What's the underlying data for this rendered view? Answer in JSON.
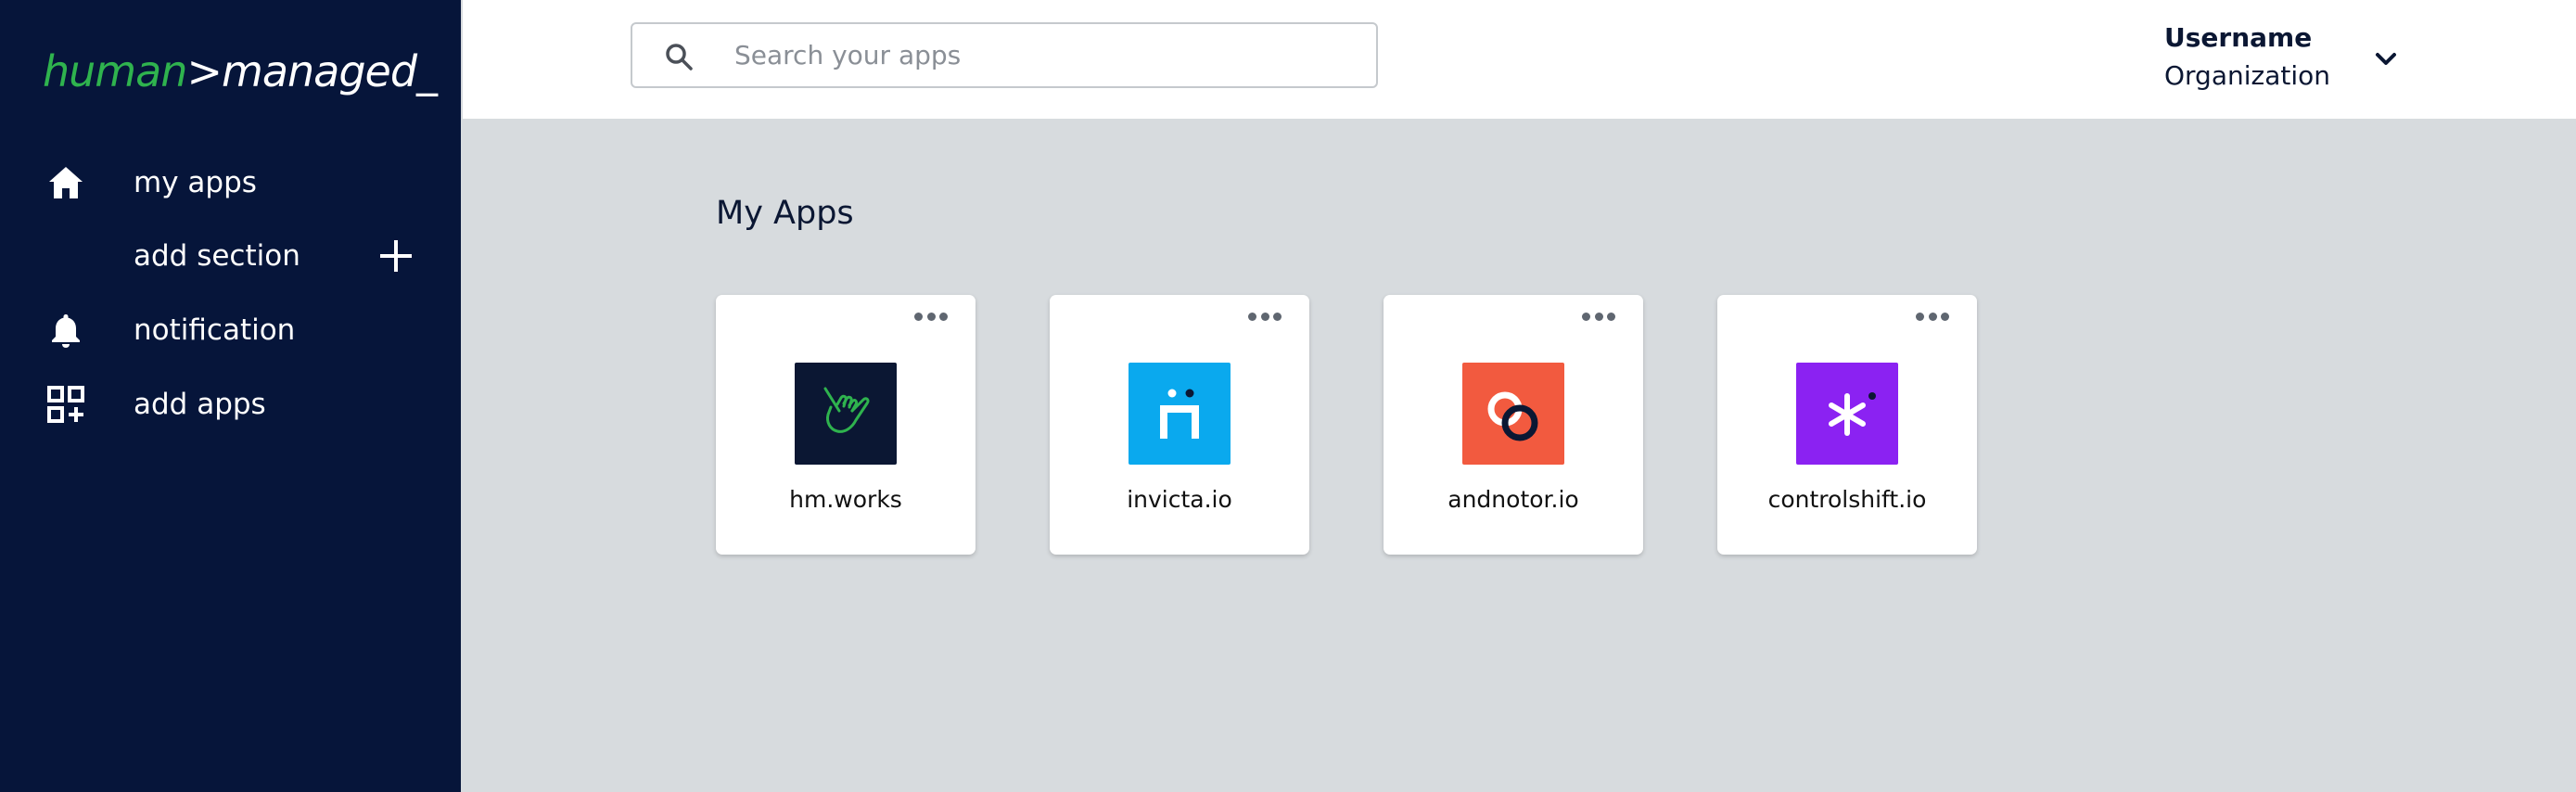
{
  "brand": {
    "part1": "human",
    "part2": ">managed_"
  },
  "sidebar": {
    "items": [
      {
        "label": "my apps",
        "icon": "home-icon"
      },
      {
        "label": "add section",
        "icon": "plus-icon"
      },
      {
        "label": "notification",
        "icon": "bell-icon"
      },
      {
        "label": "add apps",
        "icon": "add-apps-grid-icon"
      }
    ]
  },
  "search": {
    "placeholder": "Search your apps",
    "value": ""
  },
  "user": {
    "username": "Username",
    "organization": "Organization"
  },
  "main": {
    "title": "My Apps",
    "apps": [
      {
        "name": "hm.works",
        "logo_color": "#0b1733",
        "icon": "hand-icon"
      },
      {
        "name": "invicta.io",
        "logo_color": "#0aa9ee",
        "icon": "invicta-logo-icon"
      },
      {
        "name": "andnotor.io",
        "logo_color": "#f25a3f",
        "icon": "rings-icon"
      },
      {
        "name": "controlshift.io",
        "logo_color": "#8b22f2",
        "icon": "asterisk-icon"
      }
    ]
  },
  "colors": {
    "sidebar_bg": "#06153a",
    "brand_green": "#2fb34e",
    "main_bg": "#d7dbde"
  }
}
